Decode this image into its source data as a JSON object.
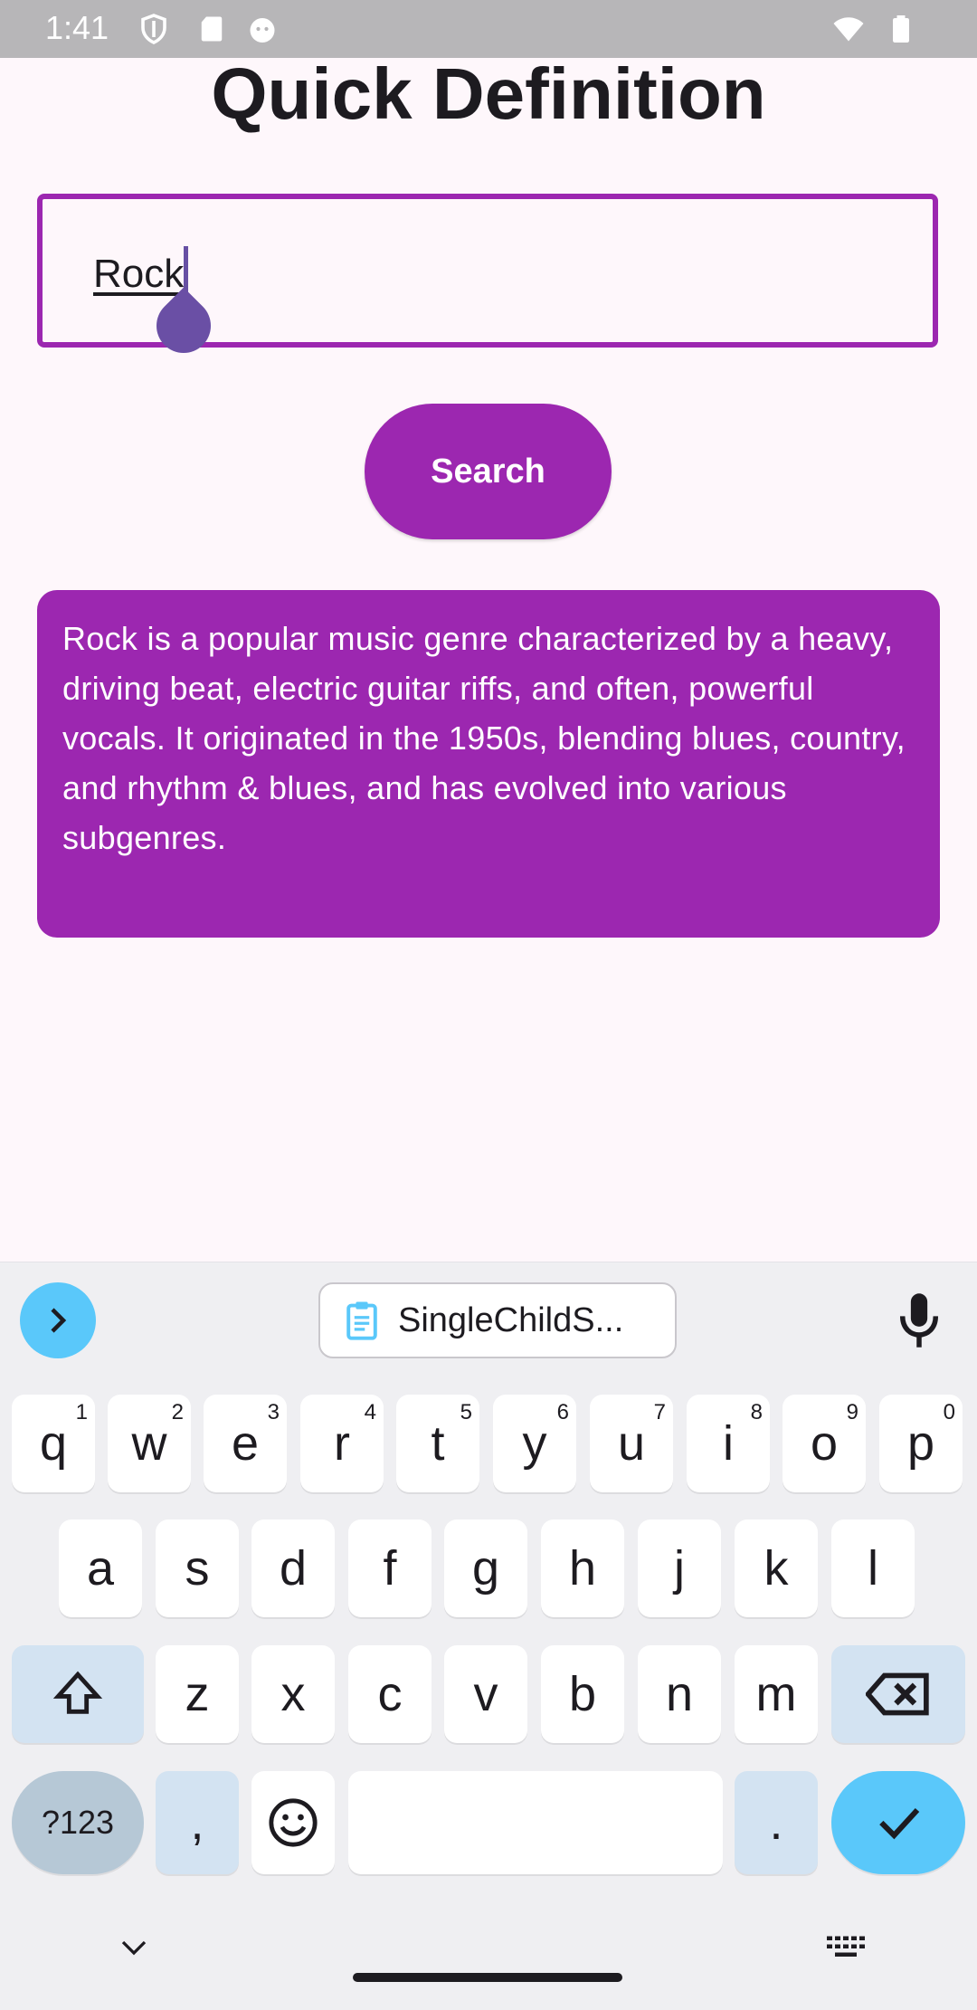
{
  "status_bar": {
    "time": "1:41"
  },
  "app": {
    "title": "Quick Definition",
    "input_value": "Rock",
    "search_label": "Search",
    "definition": "Rock is a popular music genre characterized by a heavy, driving beat, electric guitar riffs, and often, powerful vocals. It originated in the 1950s, blending blues, country, and rhythm & blues, and has evolved into various subgenres.",
    "accent_color": "#9c27b0"
  },
  "keyboard": {
    "clipboard_suggestion": "SingleChildS...",
    "row1": [
      {
        "key": "q",
        "hint": "1"
      },
      {
        "key": "w",
        "hint": "2"
      },
      {
        "key": "e",
        "hint": "3"
      },
      {
        "key": "r",
        "hint": "4"
      },
      {
        "key": "t",
        "hint": "5"
      },
      {
        "key": "y",
        "hint": "6"
      },
      {
        "key": "u",
        "hint": "7"
      },
      {
        "key": "i",
        "hint": "8"
      },
      {
        "key": "o",
        "hint": "9"
      },
      {
        "key": "p",
        "hint": "0"
      }
    ],
    "row2": [
      "a",
      "s",
      "d",
      "f",
      "g",
      "h",
      "j",
      "k",
      "l"
    ],
    "row3": [
      "z",
      "x",
      "c",
      "v",
      "b",
      "n",
      "m"
    ],
    "symbols_label": "?123",
    "comma_label": ",",
    "period_label": "."
  }
}
